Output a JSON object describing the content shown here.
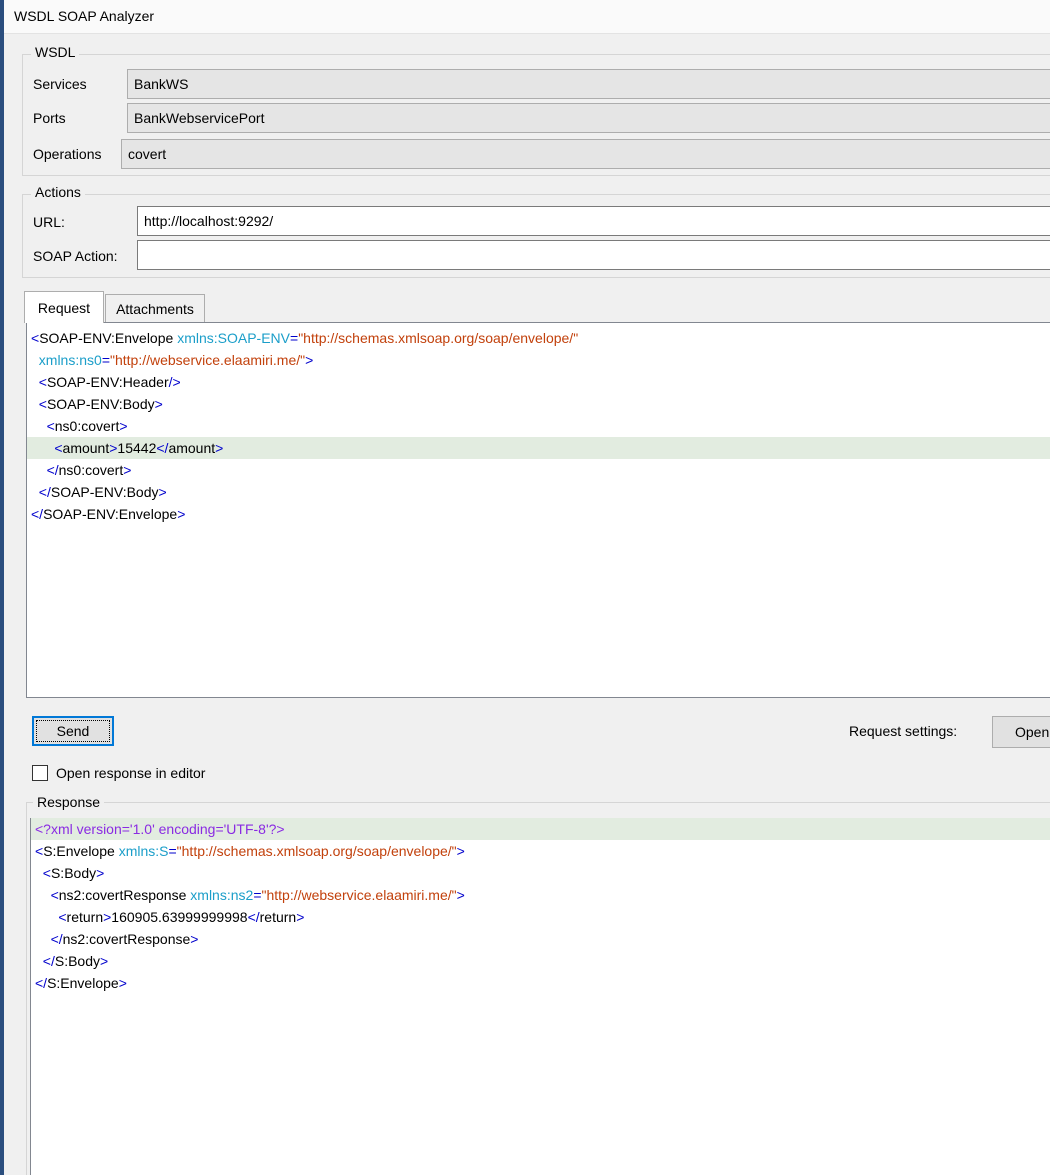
{
  "window": {
    "title": "WSDL SOAP Analyzer"
  },
  "wsdl": {
    "legend": "WSDL",
    "services_label": "Services",
    "services_value": "BankWS",
    "ports_label": "Ports",
    "ports_value": "BankWebservicePort",
    "operations_label": "Operations",
    "operations_value": "covert"
  },
  "actions": {
    "legend": "Actions",
    "url_label": "URL:",
    "url_value": "http://localhost:9292/",
    "soap_action_label": "SOAP Action:",
    "soap_action_value": ""
  },
  "tabs": [
    {
      "label": "Request",
      "active": true
    },
    {
      "label": "Attachments",
      "active": false
    }
  ],
  "request": {
    "lines": [
      [
        [
          "tg",
          "<"
        ],
        [
          "tn",
          "SOAP-ENV:Envelope"
        ],
        [
          "tx",
          " "
        ],
        [
          "an",
          "xmlns:SOAP-ENV"
        ],
        [
          "tg",
          "="
        ],
        [
          "av",
          "\"http://schemas.xmlsoap.org/soap/envelope/\""
        ]
      ],
      [
        [
          "tx",
          "  "
        ],
        [
          "an",
          "xmlns:ns0"
        ],
        [
          "tg",
          "="
        ],
        [
          "av",
          "\"http://webservice.elaamiri.me/\""
        ],
        [
          "tg",
          ">"
        ]
      ],
      [
        [
          "tx",
          "  "
        ],
        [
          "tg",
          "<"
        ],
        [
          "tn",
          "SOAP-ENV:Header"
        ],
        [
          "tg",
          "/>"
        ]
      ],
      [
        [
          "tx",
          "  "
        ],
        [
          "tg",
          "<"
        ],
        [
          "tn",
          "SOAP-ENV:Body"
        ],
        [
          "tg",
          ">"
        ]
      ],
      [
        [
          "tx",
          "    "
        ],
        [
          "tg",
          "<"
        ],
        [
          "tn",
          "ns0:covert"
        ],
        [
          "tg",
          ">"
        ]
      ],
      [
        [
          "tx",
          "      "
        ],
        [
          "tg",
          "<"
        ],
        [
          "tn",
          "amount"
        ],
        [
          "tg",
          ">"
        ],
        [
          "tx",
          "15442"
        ],
        [
          "tg",
          "</"
        ],
        [
          "tn",
          "amount"
        ],
        [
          "tg",
          ">"
        ]
      ],
      [
        [
          "tx",
          "    "
        ],
        [
          "tg",
          "</"
        ],
        [
          "tn",
          "ns0:covert"
        ],
        [
          "tg",
          ">"
        ]
      ],
      [
        [
          "tx",
          "  "
        ],
        [
          "tg",
          "</"
        ],
        [
          "tn",
          "SOAP-ENV:Body"
        ],
        [
          "tg",
          ">"
        ]
      ],
      [
        [
          "tg",
          "</"
        ],
        [
          "tn",
          "SOAP-ENV:Envelope"
        ],
        [
          "tg",
          ">"
        ]
      ]
    ],
    "highlight_line": 5
  },
  "controls": {
    "send_label": "Send",
    "request_settings_label": "Request settings:",
    "open_label": "Open",
    "open_response_label": "Open response in editor",
    "open_response_checked": false
  },
  "response": {
    "legend": "Response",
    "lines": [
      [
        [
          "pi",
          "<?xml version='1.0' encoding='UTF-8'?>"
        ]
      ],
      [
        [
          "tg",
          "<"
        ],
        [
          "tn",
          "S:Envelope"
        ],
        [
          "tx",
          " "
        ],
        [
          "an",
          "xmlns:S"
        ],
        [
          "tg",
          "="
        ],
        [
          "av",
          "\"http://schemas.xmlsoap.org/soap/envelope/\""
        ],
        [
          "tg",
          ">"
        ]
      ],
      [
        [
          "tx",
          "  "
        ],
        [
          "tg",
          "<"
        ],
        [
          "tn",
          "S:Body"
        ],
        [
          "tg",
          ">"
        ]
      ],
      [
        [
          "tx",
          "    "
        ],
        [
          "tg",
          "<"
        ],
        [
          "tn",
          "ns2:covertResponse"
        ],
        [
          "tx",
          " "
        ],
        [
          "an",
          "xmlns:ns2"
        ],
        [
          "tg",
          "="
        ],
        [
          "av",
          "\"http://webservice.elaamiri.me/\""
        ],
        [
          "tg",
          ">"
        ]
      ],
      [
        [
          "tx",
          "      "
        ],
        [
          "tg",
          "<"
        ],
        [
          "tn",
          "return"
        ],
        [
          "tg",
          ">"
        ],
        [
          "tx",
          "160905.63999999998"
        ],
        [
          "tg",
          "</"
        ],
        [
          "tn",
          "return"
        ],
        [
          "tg",
          ">"
        ]
      ],
      [
        [
          "tx",
          "    "
        ],
        [
          "tg",
          "</"
        ],
        [
          "tn",
          "ns2:covertResponse"
        ],
        [
          "tg",
          ">"
        ]
      ],
      [
        [
          "tx",
          "  "
        ],
        [
          "tg",
          "</"
        ],
        [
          "tn",
          "S:Body"
        ],
        [
          "tg",
          ">"
        ]
      ],
      [
        [
          "tg",
          "</"
        ],
        [
          "tn",
          "S:Envelope"
        ],
        [
          "tg",
          ">"
        ]
      ]
    ],
    "highlight_line": 0
  }
}
